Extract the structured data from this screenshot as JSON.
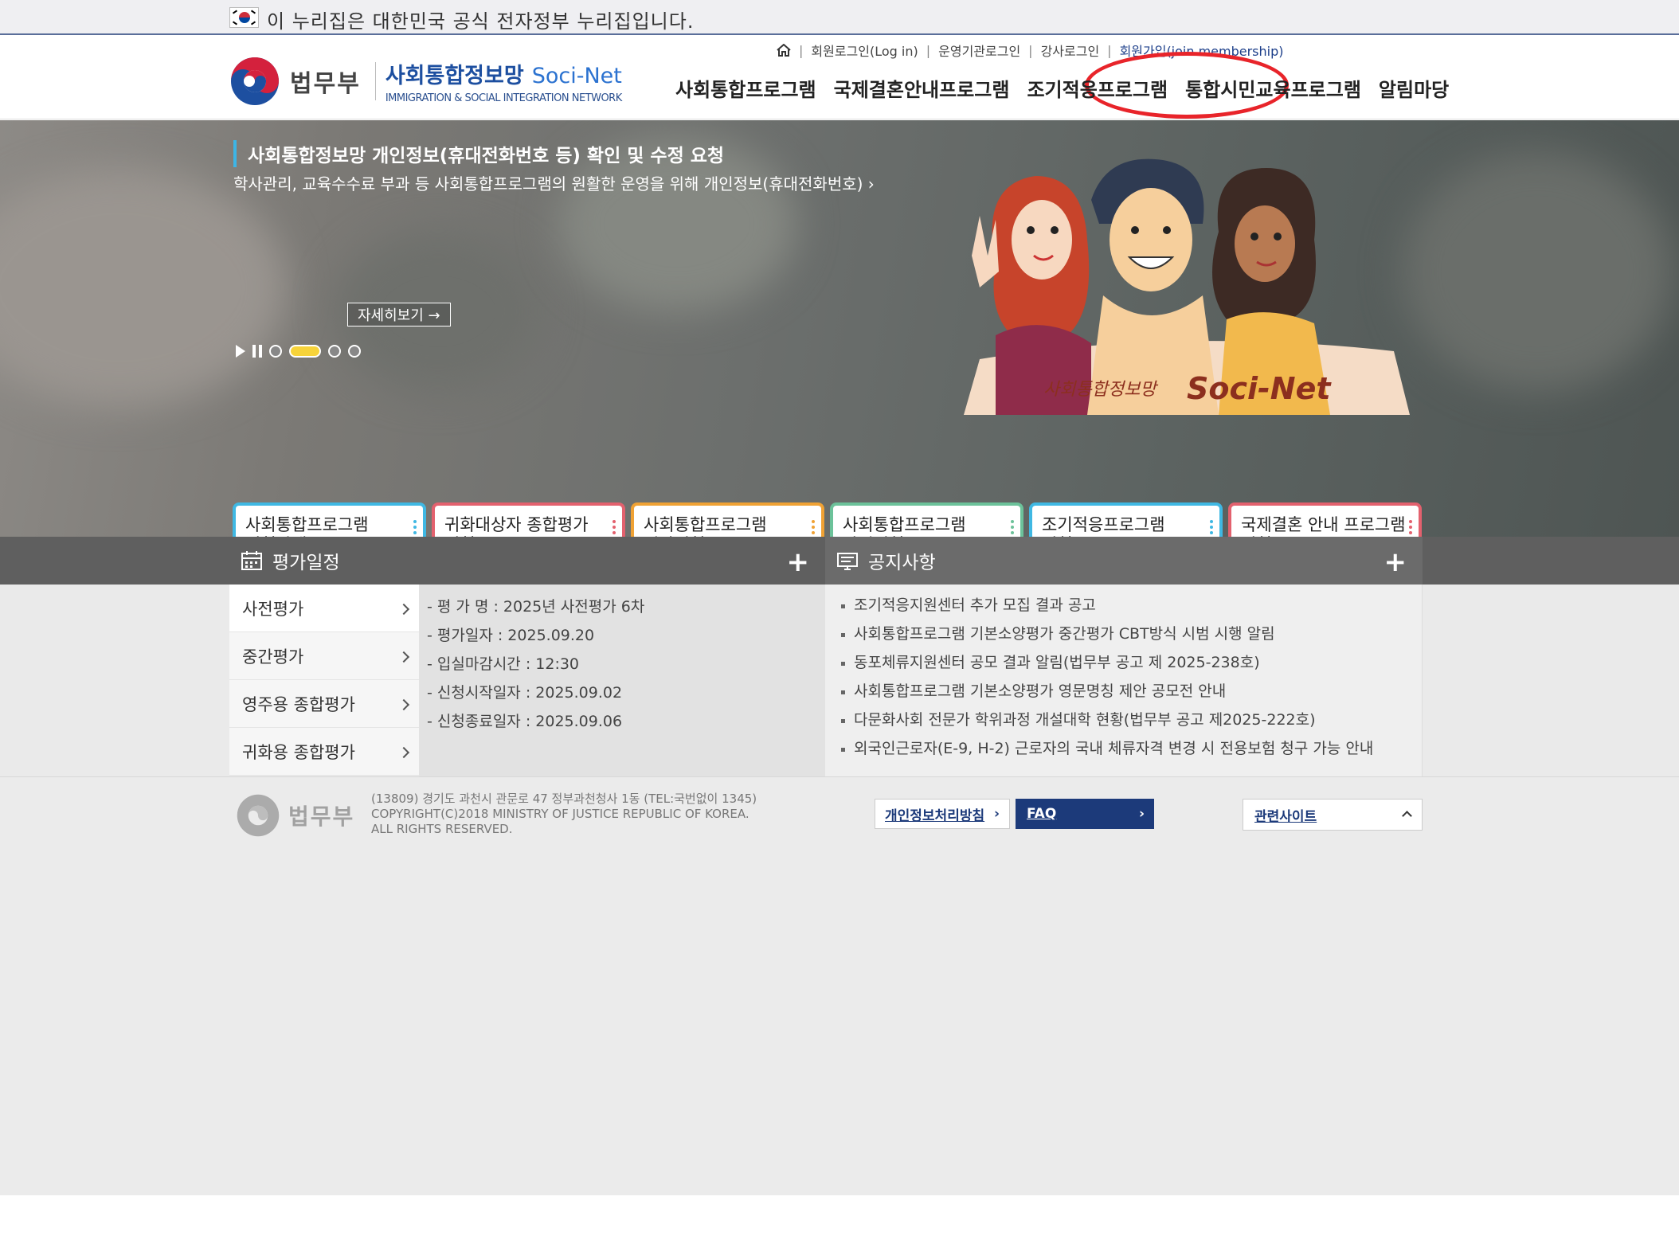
{
  "gov_banner": {
    "text": "이 누리집은 대한민국 공식 전자정부 누리집입니다."
  },
  "util_nav": {
    "home_icon": "home-icon",
    "items": [
      "회원로그인(Log in)",
      "운영기관로그인",
      "강사로그인",
      "회원가입(join membership)"
    ]
  },
  "logo": {
    "ministry": "법무부",
    "brand_kr": "사회통합정보망",
    "brand_en": "Soci-Net",
    "brand_sub": "IMMIGRATION & SOCIAL INTEGRATION NETWORK"
  },
  "gnb": [
    "사회통합프로그램",
    "국제결혼안내프로그램",
    "조기적응프로그램",
    "통합시민교육프로그램",
    "알림마당"
  ],
  "hero": {
    "notice_title": "사회통합정보망 개인정보(휴대전화번호 등) 확인 및 수정 요청",
    "notice_desc": "학사관리, 교육수수료 부과 등 사회통합프로그램의 원활한 운영을 위해 개인정보(휴대전화번호) ›",
    "more_label": "자세히보기 →",
    "illust_text": "사회통합정보망 Soci-Net",
    "slides_total": 4,
    "active_slide": 2
  },
  "quick_cards": [
    {
      "label": "사회통합프로그램\n신청안내",
      "color": "#3fb8e3",
      "icon": "book-search-icon"
    },
    {
      "label": "귀화대상자 종합평가\n신청",
      "color": "#e3616e",
      "icon": "graduation-globe-icon"
    },
    {
      "label": "사회통합프로그램\n평가신청",
      "color": "#f0a234",
      "icon": "presentation-icon"
    },
    {
      "label": "사회통합프로그램\n과정신청",
      "color": "#6cc29a",
      "icon": "checklist-person-icon"
    },
    {
      "label": "조기적응프로그램\n신청",
      "color": "#3fb8e3",
      "icon": "id-card-icon"
    },
    {
      "label": "국제결혼 안내 프로그램\n신청",
      "color": "#e3616e",
      "icon": "couple-icon"
    }
  ],
  "eval": {
    "title": "평가일정",
    "tabs": [
      "사전평가",
      "중간평가",
      "영주용 종합평가",
      "귀화용 종합평가"
    ],
    "details": [
      "평 가 명 : 2025년 사전평가 6차",
      "평가일자 : 2025.09.20",
      "입실마감시간 : 12:30",
      "신청시작일자 : 2025.09.02",
      "신청종료일자 : 2025.09.06"
    ]
  },
  "notice": {
    "title": "공지사항",
    "items": [
      "조기적응지원센터 추가 모집 결과 공고",
      "사회통합프로그램 기본소양평가 중간평가 CBT방식 시범 시행 알림",
      "동포체류지원센터 공모 결과 알림(법무부 공고 제 2025-238호)",
      "사회통합프로그램 기본소양평가 영문명칭 제안 공모전 안내",
      "다문화사회 전문가 학위과정 개설대학 현황(법무부 공고 제2025-222호)",
      "외국인근로자(E-9, H-2) 근로자의 국내 체류자격 변경 시 전용보험 청구 가능 안내"
    ]
  },
  "footer": {
    "ministry": "법무부",
    "address": "(13809) 경기도 과천시 관문로 47 정부과천청사 1동 (TEL:국번없이 1345)",
    "copyright1": "COPYRIGHT(C)2018 MINISTRY OF JUSTICE REPUBLIC OF KOREA.",
    "copyright2": "ALL RIGHTS RESERVED.",
    "privacy_label": "개인정보처리방침",
    "faq_label": "FAQ",
    "related_label": "관련사이트"
  }
}
